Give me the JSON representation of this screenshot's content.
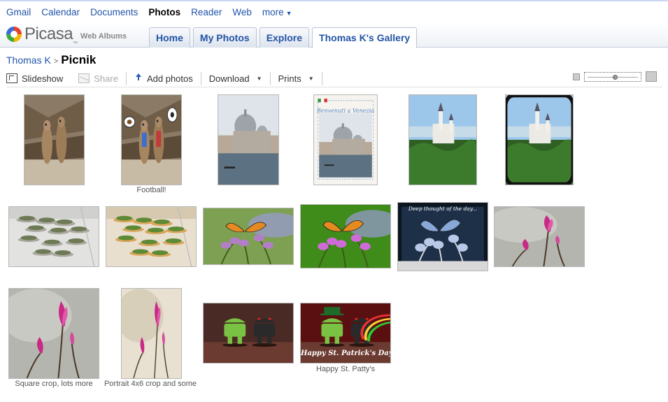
{
  "google_bar": {
    "links": [
      "Gmail",
      "Calendar",
      "Documents",
      "Photos",
      "Reader",
      "Web",
      "more"
    ],
    "active": "Photos"
  },
  "header": {
    "logo_text": "Picasa",
    "logo_tm": "™",
    "logo_sub": "Web Albums",
    "tabs": [
      "Home",
      "My Photos",
      "Explore",
      "Thomas K's Gallery"
    ],
    "active_tab": "Thomas K's Gallery"
  },
  "breadcrumb": {
    "owner": "Thomas K",
    "separator": ">",
    "album": "Picnik"
  },
  "toolbar": {
    "slideshow": "Slideshow",
    "share": "Share",
    "add_photos": "Add photos",
    "download": "Download",
    "prints": "Prints",
    "zoom_level": 0.55
  },
  "colors": {
    "link": "#2255aa",
    "tab_border": "#b9c6d8"
  },
  "photos": [
    {
      "subject": "meerkats",
      "caption": ""
    },
    {
      "subject": "meerkats-football",
      "caption": "Football!"
    },
    {
      "subject": "venice",
      "caption": ""
    },
    {
      "subject": "venice-postcard",
      "caption": "",
      "text": "Benvenuti a Venezia"
    },
    {
      "subject": "castle",
      "caption": ""
    },
    {
      "subject": "castle-vignette",
      "caption": ""
    },
    {
      "subject": "stone-planters",
      "caption": ""
    },
    {
      "subject": "stone-planters-warm",
      "caption": ""
    },
    {
      "subject": "butterfly",
      "caption": ""
    },
    {
      "subject": "butterfly-vivid",
      "caption": ""
    },
    {
      "subject": "butterfly-dark",
      "caption": "",
      "text": "Deep thought of the day..."
    },
    {
      "subject": "magnolia",
      "caption": ""
    },
    {
      "subject": "magnolia-square",
      "caption": "Square crop, lots more"
    },
    {
      "subject": "magnolia-portrait",
      "caption": "Portrait 4x6 crop and some"
    },
    {
      "subject": "androids",
      "caption": ""
    },
    {
      "subject": "androids-stpatty",
      "caption": "Happy St. Patty's",
      "text": "Happy St. Patrick's Day!"
    }
  ]
}
